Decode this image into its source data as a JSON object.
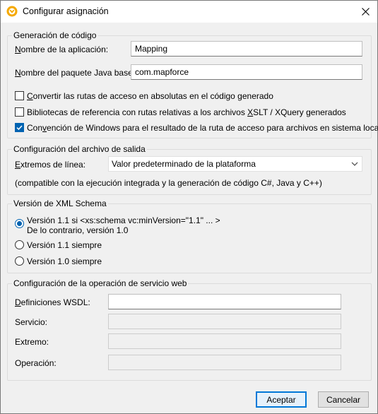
{
  "window": {
    "title": "Configurar asignación"
  },
  "code_generation": {
    "title": "Generación de código",
    "app_name_label": "Nombre de la aplicación:",
    "app_name_value": "Mapping",
    "java_package_label": "Nombre del paquete Java base:",
    "java_package_value": "com.mapforce",
    "options": [
      {
        "label": "Convertir las rutas de acceso en absolutas en el código generado",
        "checked": false
      },
      {
        "label": "Bibliotecas de referencia con rutas relativas a los archivos XSLT / XQuery generados",
        "checked": false
      },
      {
        "label": "Convención de Windows para el resultado de la ruta de acceso para archivos en sistema local",
        "checked": true
      }
    ]
  },
  "output_config": {
    "title": "Configuración del archivo de salida",
    "line_ends_label": "Extremos de línea:",
    "line_ends_value": "Valor predeterminado de la plataforma",
    "note": "(compatible con la ejecución integrada y la generación de código C#, Java y C++)"
  },
  "xml_schema": {
    "title": "Versión de XML Schema",
    "options": [
      {
        "line1": "Versión 1.1 si <xs:schema vc:minVersion=\"1.1\" ... >",
        "line2": "De lo contrario, versión 1.0",
        "checked": true
      },
      {
        "line1": "Versión 1.1 siempre",
        "checked": false
      },
      {
        "line1": "Versión 1.0 siempre",
        "checked": false
      }
    ]
  },
  "web_service": {
    "title": "Configuración de la operación de servicio web",
    "wsdl_label": "Definiciones WSDL:",
    "service_label": "Servicio:",
    "endpoint_label": "Extremo:",
    "operation_label": "Operación:"
  },
  "buttons": {
    "ok": "Aceptar",
    "cancel": "Cancelar"
  },
  "colors": {
    "accent": "#0063b1",
    "app_icon": "#f5a800"
  }
}
